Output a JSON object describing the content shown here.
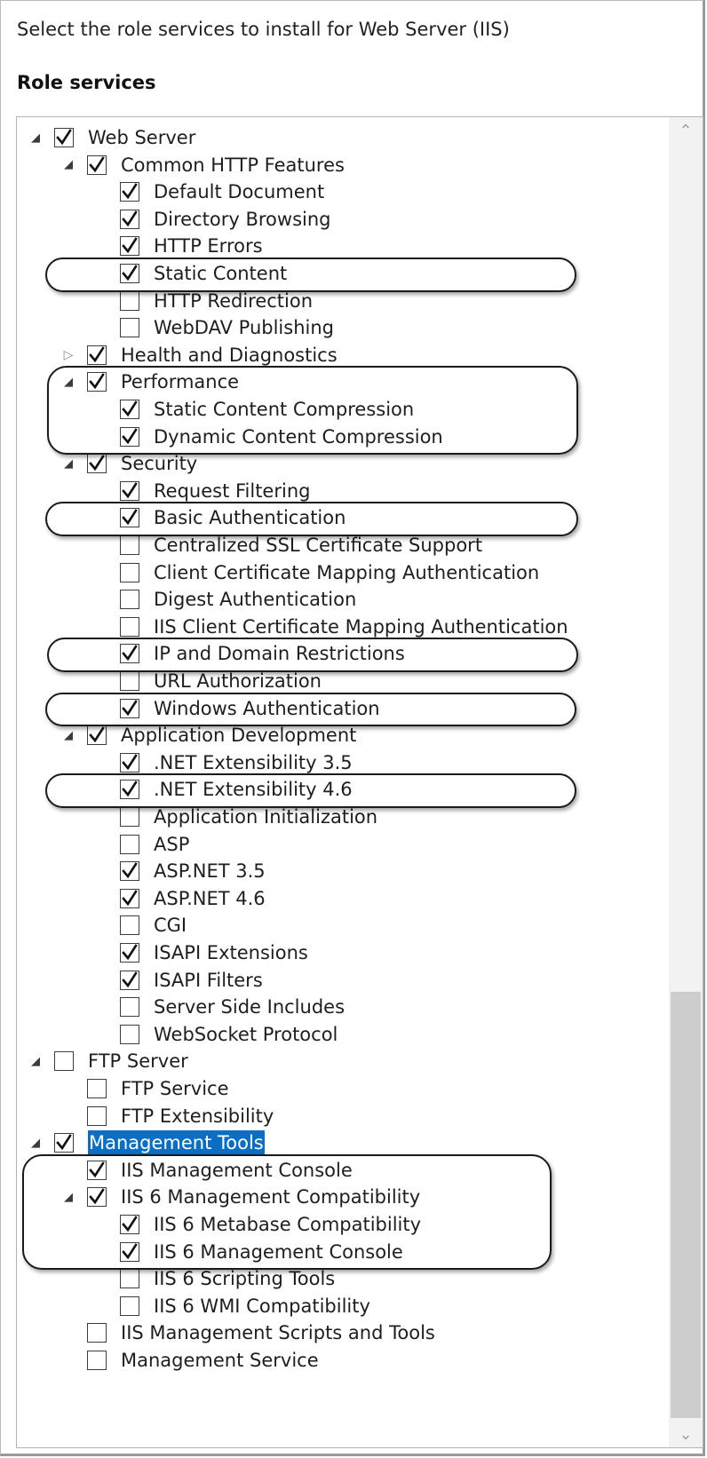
{
  "header": {
    "instruction": "Select the role services to install for Web Server (IIS)",
    "section_title": "Role services"
  },
  "tree": [
    {
      "label": "Web Server",
      "level": 0,
      "checked": true,
      "expander": "expanded"
    },
    {
      "label": "Common HTTP Features",
      "level": 1,
      "checked": true,
      "expander": "expanded"
    },
    {
      "label": "Default Document",
      "level": 2,
      "checked": true,
      "expander": "none"
    },
    {
      "label": "Directory Browsing",
      "level": 2,
      "checked": true,
      "expander": "none"
    },
    {
      "label": "HTTP Errors",
      "level": 2,
      "checked": true,
      "expander": "none"
    },
    {
      "label": "Static Content",
      "level": 2,
      "checked": true,
      "expander": "none"
    },
    {
      "label": "HTTP Redirection",
      "level": 2,
      "checked": false,
      "expander": "none"
    },
    {
      "label": "WebDAV Publishing",
      "level": 2,
      "checked": false,
      "expander": "none"
    },
    {
      "label": "Health and Diagnostics",
      "level": 1,
      "checked": true,
      "expander": "collapsed"
    },
    {
      "label": "Performance",
      "level": 1,
      "checked": true,
      "expander": "expanded"
    },
    {
      "label": "Static Content Compression",
      "level": 2,
      "checked": true,
      "expander": "none"
    },
    {
      "label": "Dynamic Content Compression",
      "level": 2,
      "checked": true,
      "expander": "none"
    },
    {
      "label": "Security",
      "level": 1,
      "checked": true,
      "expander": "expanded"
    },
    {
      "label": "Request Filtering",
      "level": 2,
      "checked": true,
      "expander": "none"
    },
    {
      "label": "Basic Authentication",
      "level": 2,
      "checked": true,
      "expander": "none"
    },
    {
      "label": "Centralized SSL Certificate Support",
      "level": 2,
      "checked": false,
      "expander": "none"
    },
    {
      "label": "Client Certificate Mapping Authentication",
      "level": 2,
      "checked": false,
      "expander": "none"
    },
    {
      "label": "Digest Authentication",
      "level": 2,
      "checked": false,
      "expander": "none"
    },
    {
      "label": "IIS Client Certificate Mapping Authentication",
      "level": 2,
      "checked": false,
      "expander": "none"
    },
    {
      "label": "IP and Domain Restrictions",
      "level": 2,
      "checked": true,
      "expander": "none"
    },
    {
      "label": "URL Authorization",
      "level": 2,
      "checked": false,
      "expander": "none"
    },
    {
      "label": "Windows Authentication",
      "level": 2,
      "checked": true,
      "expander": "none"
    },
    {
      "label": "Application Development",
      "level": 1,
      "checked": true,
      "expander": "expanded"
    },
    {
      "label": ".NET Extensibility 3.5",
      "level": 2,
      "checked": true,
      "expander": "none"
    },
    {
      "label": ".NET Extensibility 4.6",
      "level": 2,
      "checked": true,
      "expander": "none"
    },
    {
      "label": "Application Initialization",
      "level": 2,
      "checked": false,
      "expander": "none"
    },
    {
      "label": "ASP",
      "level": 2,
      "checked": false,
      "expander": "none"
    },
    {
      "label": "ASP.NET 3.5",
      "level": 2,
      "checked": true,
      "expander": "none"
    },
    {
      "label": "ASP.NET 4.6",
      "level": 2,
      "checked": true,
      "expander": "none"
    },
    {
      "label": "CGI",
      "level": 2,
      "checked": false,
      "expander": "none"
    },
    {
      "label": "ISAPI Extensions",
      "level": 2,
      "checked": true,
      "expander": "none"
    },
    {
      "label": "ISAPI Filters",
      "level": 2,
      "checked": true,
      "expander": "none"
    },
    {
      "label": "Server Side Includes",
      "level": 2,
      "checked": false,
      "expander": "none"
    },
    {
      "label": "WebSocket Protocol",
      "level": 2,
      "checked": false,
      "expander": "none"
    },
    {
      "label": "FTP Server",
      "level": 0,
      "checked": false,
      "expander": "expanded"
    },
    {
      "label": "FTP Service",
      "level": 1,
      "checked": false,
      "expander": "none"
    },
    {
      "label": "FTP Extensibility",
      "level": 1,
      "checked": false,
      "expander": "none"
    },
    {
      "label": "Management Tools",
      "level": 0,
      "checked": true,
      "expander": "expanded",
      "selected": true
    },
    {
      "label": "IIS Management Console",
      "level": 1,
      "checked": true,
      "expander": "none"
    },
    {
      "label": "IIS 6 Management Compatibility",
      "level": 1,
      "checked": true,
      "expander": "expanded"
    },
    {
      "label": "IIS 6 Metabase Compatibility",
      "level": 2,
      "checked": true,
      "expander": "none"
    },
    {
      "label": "IIS 6 Management Console",
      "level": 2,
      "checked": true,
      "expander": "none"
    },
    {
      "label": "IIS 6 Scripting Tools",
      "level": 2,
      "checked": false,
      "expander": "none"
    },
    {
      "label": "IIS 6 WMI Compatibility",
      "level": 2,
      "checked": false,
      "expander": "none"
    },
    {
      "label": "IIS Management Scripts and Tools",
      "level": 1,
      "checked": false,
      "expander": "none"
    },
    {
      "label": "Management Service",
      "level": 1,
      "checked": false,
      "expander": "none"
    }
  ],
  "annotations": [
    {
      "rows": [
        5,
        5
      ]
    },
    {
      "rows": [
        9,
        11
      ]
    },
    {
      "rows": [
        14,
        14
      ]
    },
    {
      "rows": [
        19,
        19
      ]
    },
    {
      "rows": [
        21,
        21
      ]
    },
    {
      "rows": [
        24,
        24
      ]
    },
    {
      "rows": [
        38,
        41
      ]
    }
  ],
  "icons": {
    "expanded": "triangle-expanded-icon",
    "collapsed": "triangle-collapsed-icon",
    "check": "checkmark-icon"
  },
  "colors": {
    "selection": "#0a6fc4",
    "annotation_ring": "#1a1a1a"
  }
}
